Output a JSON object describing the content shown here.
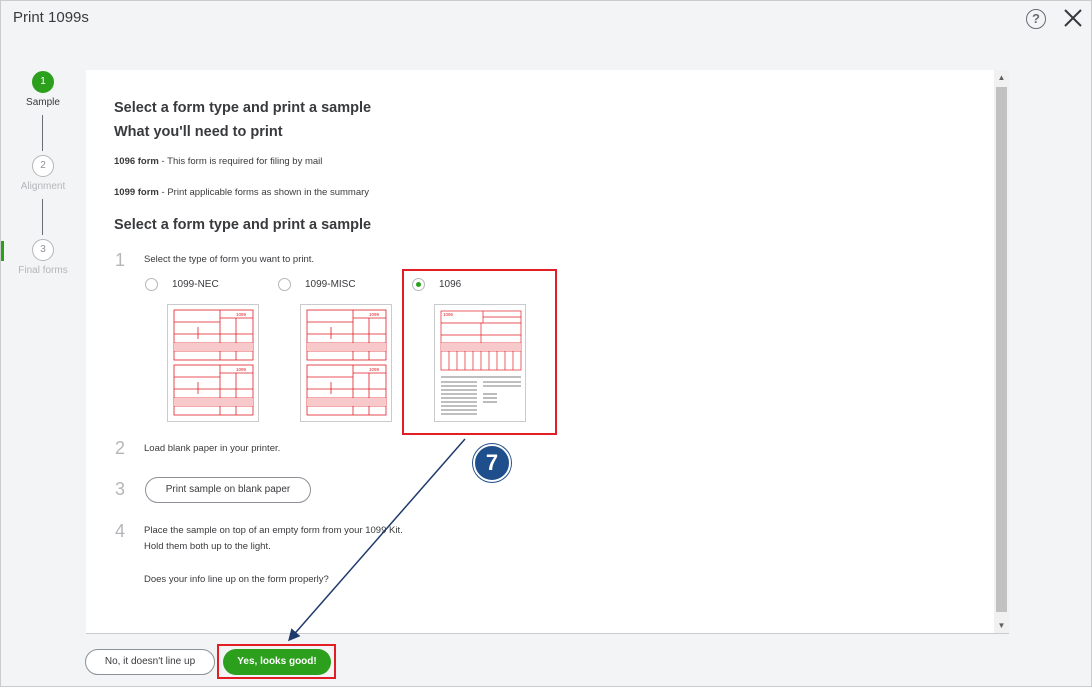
{
  "window": {
    "title": "Print 1099s"
  },
  "stepper": {
    "steps": [
      {
        "number": "1",
        "label": "Sample"
      },
      {
        "number": "2",
        "label": "Alignment"
      },
      {
        "number": "3",
        "label": "Final forms"
      }
    ]
  },
  "content": {
    "heading1": "Select a form type and print a sample",
    "heading2": "What you'll need to print",
    "need_1096_bold": "1096 form",
    "need_1096_text": " - This form is required for filing by mail",
    "need_1099_bold": "1099 form",
    "need_1099_text": " - Print applicable forms as shown in the summary",
    "heading3": "Select a form type and print a sample",
    "step1": {
      "number": "1",
      "text": "Select the type of form you want to print."
    },
    "options": [
      {
        "label": "1099-NEC",
        "checked": false
      },
      {
        "label": "1099-MISC",
        "checked": false
      },
      {
        "label": "1096",
        "checked": true
      }
    ],
    "form_label_1099": "1099",
    "form_label_1096": "1096",
    "step2": {
      "number": "2",
      "text": "Load blank paper in your printer."
    },
    "step3": {
      "number": "3",
      "button": "Print sample on blank paper"
    },
    "step4": {
      "number": "4",
      "line1": "Place the sample on top of an empty form from your 1099 Kit.",
      "line2": "Hold them both up to the light.",
      "question": "Does your info line up on the form properly?"
    }
  },
  "footer": {
    "no_button": "No, it doesn't line up",
    "yes_button": "Yes, looks good!"
  },
  "annotation": {
    "badge": "7"
  },
  "colors": {
    "accent_green": "#2ca01c",
    "annotation_red": "#e21d24",
    "badge_blue": "#1f4e8c"
  }
}
